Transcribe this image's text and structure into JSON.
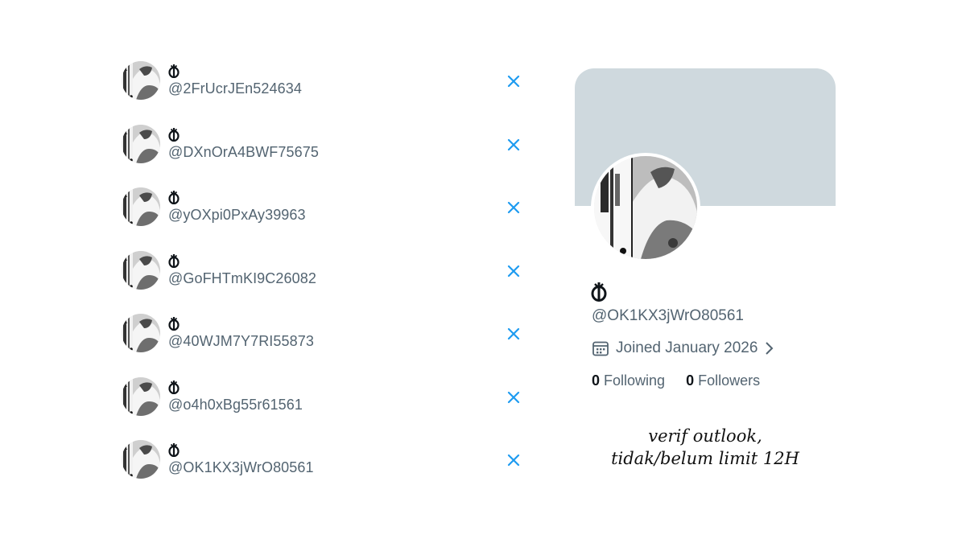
{
  "accounts": [
    {
      "handle": "@2FrUcrJEn524634"
    },
    {
      "handle": "@DXnOrA4BWF75675"
    },
    {
      "handle": "@yOXpi0PxAy39963"
    },
    {
      "handle": "@GoFHTmKI9C26082"
    },
    {
      "handle": "@40WJM7Y7RI55873"
    },
    {
      "handle": "@o4h0xBg55r61561"
    },
    {
      "handle": "@OK1KX3jWrO80561"
    }
  ],
  "profile": {
    "handle": "@OK1KX3jWrO80561",
    "joined": "Joined January 2026",
    "following_count": "0",
    "following_label": "Following",
    "followers_count": "0",
    "followers_label": "Followers",
    "banner_color": "#cfd9de"
  },
  "caption": {
    "line1": "verif outlook,",
    "line2": "tidak/belum limit 12H"
  },
  "colors": {
    "accent_blue": "#1d9bf0",
    "secondary_text": "#536471",
    "primary_text": "#0f1419"
  },
  "icons": {
    "remove": "close-icon",
    "joined": "calendar-icon",
    "joined_more": "chevron-right-icon",
    "display_name": "name-glyph-icon"
  }
}
